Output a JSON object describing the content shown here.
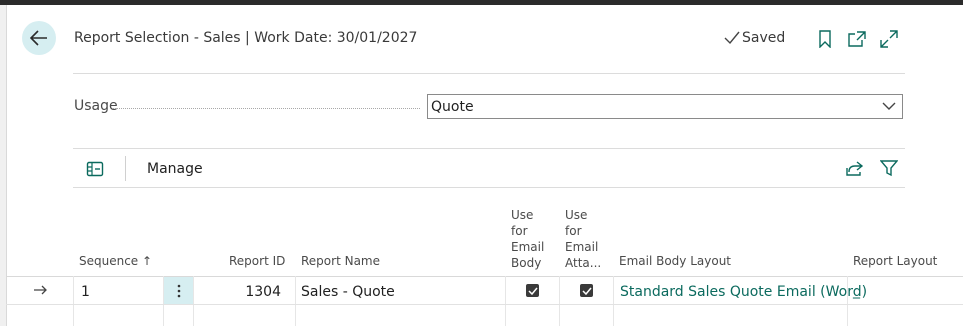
{
  "page": {
    "title": "Report Selection - Sales | Work Date: 30/01/2027",
    "status": "Saved"
  },
  "usage": {
    "label": "Usage",
    "value": "Quote"
  },
  "toolbar": {
    "manage_label": "Manage"
  },
  "table": {
    "columns": {
      "sequence": "Sequence",
      "sequence_sort": "↑",
      "report_id": "Report ID",
      "report_name": "Report Name",
      "use_email_body": [
        "Use",
        "for",
        "Email",
        "Body"
      ],
      "use_email_attach": [
        "Use",
        "for",
        "Email",
        "Atta..."
      ],
      "email_body_layout": "Email Body Layout",
      "report_layout": "Report Layout"
    },
    "rows": [
      {
        "sequence": "1",
        "report_id": "1304",
        "report_name": "Sales - Quote",
        "use_email_body": true,
        "use_email_attach": true,
        "email_body_layout": "Standard Sales Quote Email (Word)",
        "report_layout": "_"
      }
    ]
  },
  "colors": {
    "accent": "#0b6a5e",
    "highlight": "#d6eef1"
  }
}
